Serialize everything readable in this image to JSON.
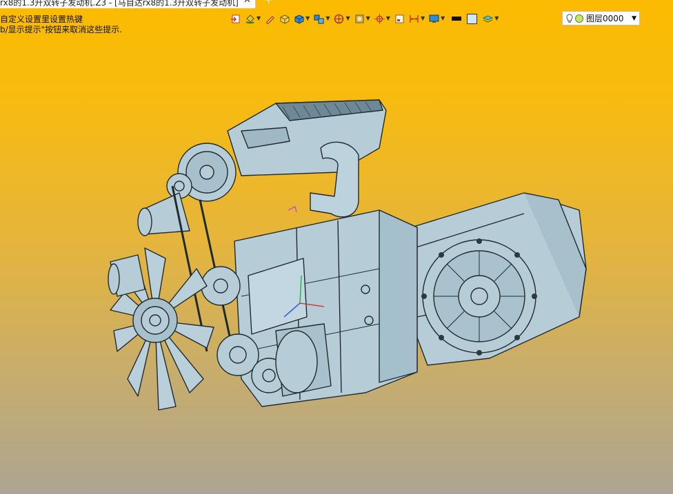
{
  "tabs": [
    {
      "label": "rx8的1.3升双转子发动机.Z3 - [马自达rx8的1.3升双转子发动机]",
      "close_icon": "close-icon"
    }
  ],
  "new_tab_label": "+",
  "hints": {
    "line1": "自定义设置里设置热键",
    "line2": "b/显示提示\"按钮来取消这些提示."
  },
  "toolbar": {
    "tools": [
      {
        "name": "import-icon"
      },
      {
        "name": "paint-bucket-icon",
        "dropdown": true
      },
      {
        "name": "pencil-icon"
      },
      {
        "name": "yellow-cube-icon"
      },
      {
        "name": "blue-cube-icon",
        "dropdown": true
      },
      {
        "name": "stacked-cubes-icon",
        "dropdown": true
      },
      {
        "name": "sphere-render-icon",
        "dropdown": true
      },
      {
        "name": "shaded-box-icon",
        "dropdown": true
      },
      {
        "name": "target-snap-icon",
        "dropdown": true
      },
      {
        "name": "frame-icon"
      },
      {
        "name": "dimension-icon",
        "dropdown": true
      },
      {
        "name": "display-settings-icon",
        "dropdown": true
      }
    ],
    "colors": {
      "line": "#111111",
      "fill": "#cfe7f5"
    },
    "layer": {
      "value": "图层0000"
    }
  },
  "engine": {
    "body_color": "#b6cdd8",
    "line_color": "#1e2a30"
  }
}
